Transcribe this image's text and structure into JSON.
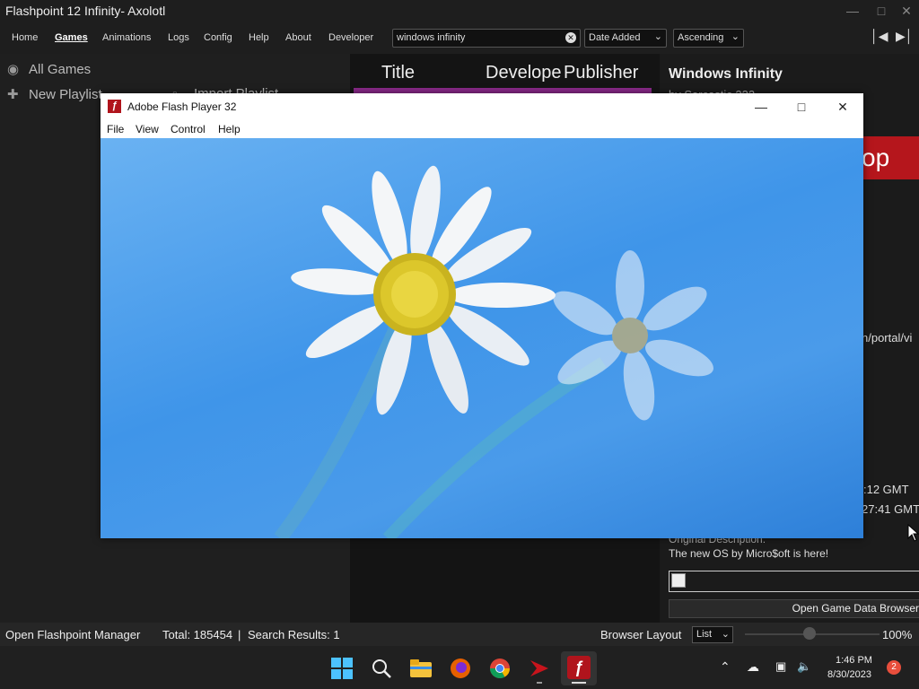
{
  "window": {
    "title": "Flashpoint 12 Infinity- Axolotl"
  },
  "menu": {
    "items": [
      "Home",
      "Games",
      "Animations",
      "Logs",
      "Config",
      "Help",
      "About",
      "Developer"
    ],
    "active": "Games"
  },
  "search": {
    "value": "windows infinity"
  },
  "sort": {
    "field": "Date Added",
    "order": "Ascending"
  },
  "sidebar": {
    "all_games": "All Games",
    "new_playlist": "New Playlist",
    "import_playlist": "Import Playlist"
  },
  "list": {
    "columns": [
      "Title",
      "Developer",
      "Publisher"
    ]
  },
  "details": {
    "title": "Windows Infinity",
    "partial_line": "by Sarcastic 222",
    "red_banner_text": "op",
    "url_fragment": "n/portal/vi",
    "time1": ":12 GMT",
    "time2": "27:41 GMT",
    "orig_desc_label": "Original Description:",
    "orig_desc": "The new OS by Micro$oft is here!",
    "open_data_button": "Open Game Data Browser"
  },
  "status": {
    "manager": "Open Flashpoint Manager",
    "total": "Total: 185454",
    "separator": "|",
    "results": "Search Results: 1",
    "browser_layout_label": "Browser Layout",
    "layout_value": "List",
    "zoom": "100%"
  },
  "flash": {
    "title": "Adobe Flash Player 32",
    "menu": [
      "File",
      "View",
      "Control",
      "Help"
    ]
  },
  "taskbar": {
    "icons": [
      "windows-start-icon",
      "search-icon",
      "file-explorer-icon",
      "firefox-icon",
      "chrome-icon",
      "flashpoint-icon",
      "flash-player-icon"
    ],
    "time": "1:46 PM",
    "date": "8/30/2023",
    "notifications": "2"
  },
  "colors": {
    "accent_purple": "#8b2a8b",
    "flash_red": "#b0141c",
    "sky": "#3f95e9"
  }
}
